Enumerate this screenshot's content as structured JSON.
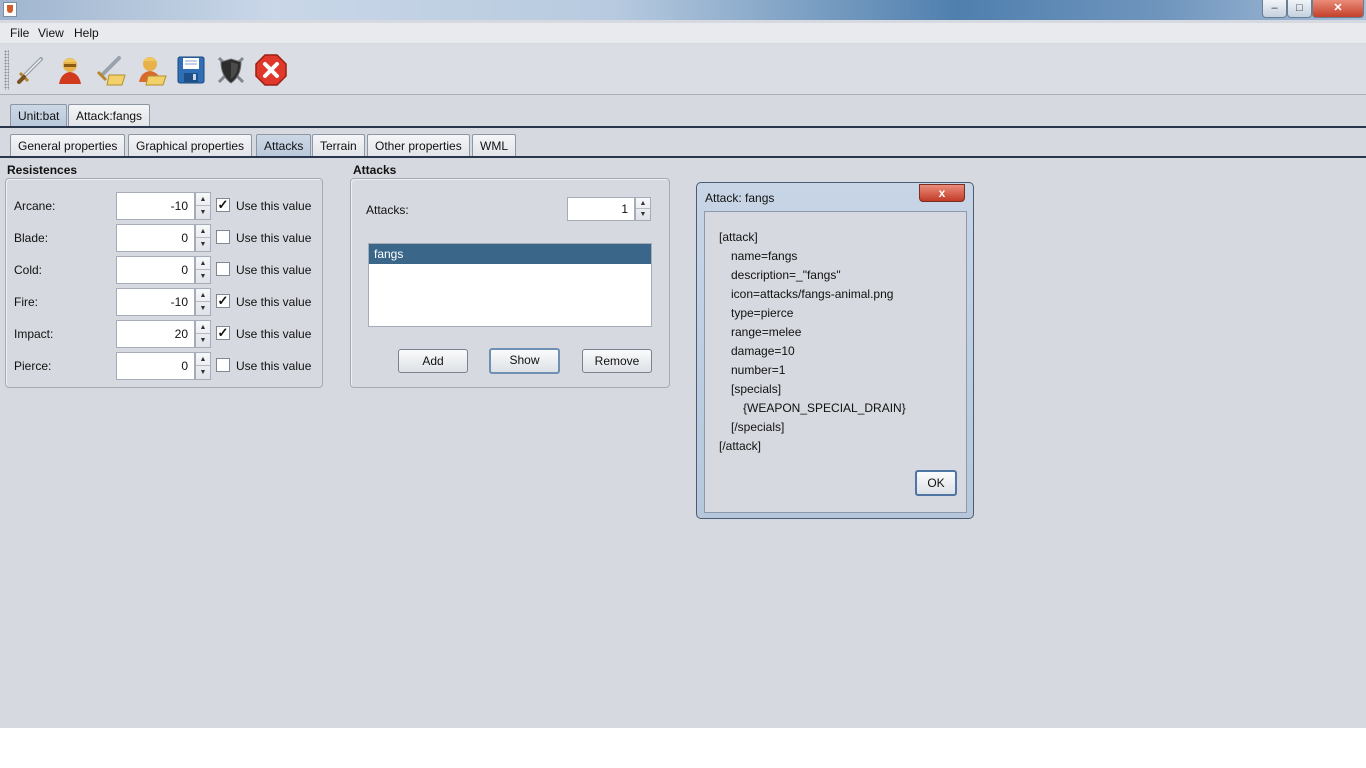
{
  "menu": {
    "file": "File",
    "view": "View",
    "help": "Help"
  },
  "toolbar": {
    "buttons": [
      "sword-icon",
      "unit-icon",
      "sword-open-icon",
      "unit-open-icon",
      "save-icon",
      "shield-icon",
      "close-icon"
    ]
  },
  "top_tabs": [
    "Unit:bat",
    "Attack:fangs"
  ],
  "sub_tabs": [
    "General properties",
    "Graphical properties",
    "Attacks",
    "Terrain",
    "Other properties",
    "WML"
  ],
  "resistances": {
    "title": "Resistences",
    "rows": [
      {
        "label": "Arcane:",
        "value": "-10",
        "checked": true,
        "check_label": "Use this value"
      },
      {
        "label": "Blade:",
        "value": "0",
        "checked": false,
        "check_label": "Use this value"
      },
      {
        "label": "Cold:",
        "value": "0",
        "checked": false,
        "check_label": "Use this value"
      },
      {
        "label": "Fire:",
        "value": "-10",
        "checked": true,
        "check_label": "Use this value"
      },
      {
        "label": "Impact:",
        "value": "20",
        "checked": true,
        "check_label": "Use this value"
      },
      {
        "label": "Pierce:",
        "value": "0",
        "checked": false,
        "check_label": "Use this value"
      }
    ]
  },
  "attacks": {
    "title": "Attacks",
    "count_label": "Attacks:",
    "count": "1",
    "list": [
      "fangs"
    ],
    "add_label": "Add",
    "show_label": "Show",
    "remove_label": "Remove"
  },
  "dialog": {
    "title": "Attack: fangs",
    "close_glyph": "x",
    "lines": [
      "[attack]",
      "name=fangs",
      "description=_\"fangs\"",
      "icon=attacks/fangs-animal.png",
      "type=pierce",
      "range=melee",
      "damage=10",
      "number=1",
      "[specials]",
      "{WEAPON_SPECIAL_DRAIN}",
      "[/specials]",
      "[/attack]"
    ],
    "ok_label": "OK"
  },
  "colors": {
    "background": "#d6d9df",
    "selection": "#3a6689",
    "close_red": "#c23c27"
  }
}
